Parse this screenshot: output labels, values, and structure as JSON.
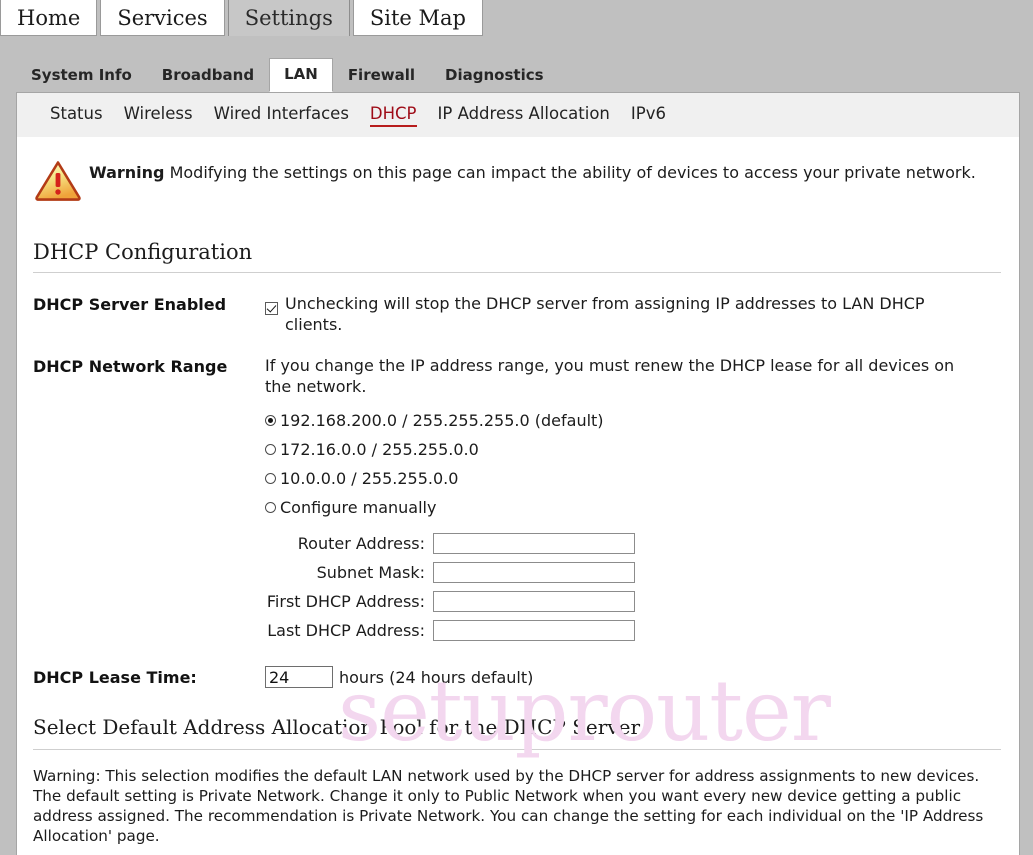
{
  "primary_nav": {
    "items": [
      {
        "label": "Home",
        "active": false
      },
      {
        "label": "Services",
        "active": false
      },
      {
        "label": "Settings",
        "active": true
      },
      {
        "label": "Site Map",
        "active": false
      }
    ]
  },
  "secondary_nav": {
    "items": [
      {
        "label": "System Info",
        "active": false
      },
      {
        "label": "Broadband",
        "active": false
      },
      {
        "label": "LAN",
        "active": true
      },
      {
        "label": "Firewall",
        "active": false
      },
      {
        "label": "Diagnostics",
        "active": false
      }
    ]
  },
  "tertiary_nav": {
    "items": [
      {
        "label": "Status",
        "active": false
      },
      {
        "label": "Wireless",
        "active": false
      },
      {
        "label": "Wired Interfaces",
        "active": false
      },
      {
        "label": "DHCP",
        "active": true
      },
      {
        "label": "IP Address Allocation",
        "active": false
      },
      {
        "label": "IPv6",
        "active": false
      }
    ]
  },
  "warning_banner": {
    "icon": "warning-triangle-icon",
    "bold_prefix": "Warning",
    "text": "Modifying the settings on this page can impact the ability of devices to access your private network."
  },
  "dhcp_configuration": {
    "heading": "DHCP Configuration",
    "server_enabled": {
      "label": "DHCP Server Enabled",
      "checked": true,
      "description": "Unchecking will stop the DHCP server from assigning IP addresses to LAN DHCP clients."
    },
    "network_range": {
      "label": "DHCP Network Range",
      "description": "If you change the IP address range, you must renew the DHCP lease for all devices on the network.",
      "options": [
        {
          "label": "192.168.200.0 / 255.255.255.0 (default)",
          "selected": true
        },
        {
          "label": "172.16.0.0 / 255.255.0.0",
          "selected": false
        },
        {
          "label": "10.0.0.0 / 255.255.0.0",
          "selected": false
        },
        {
          "label": "Configure manually",
          "selected": false
        }
      ],
      "manual_fields": [
        {
          "label": "Router Address:",
          "value": "",
          "placeholder": ""
        },
        {
          "label": "Subnet Mask:",
          "value": "",
          "placeholder": ""
        },
        {
          "label": "First DHCP Address:",
          "value": "",
          "placeholder": ""
        },
        {
          "label": "Last DHCP Address:",
          "value": "",
          "placeholder": ""
        }
      ]
    },
    "lease_time": {
      "label": "DHCP Lease Time:",
      "value": "24",
      "suffix": "hours (24 hours default)"
    }
  },
  "allocation_pool": {
    "heading": "Select Default Address Allocation Pool for the DHCP Server",
    "note": "Warning: This selection modifies the default LAN network used by the DHCP server for address assignments to new devices. The default setting is Private Network. Change it only to Public Network when you want every new device getting a public address assigned. The recommendation is Private Network. You can change the setting for each individual on the 'IP Address Allocation' page."
  },
  "watermark": {
    "text": "setuprouter"
  },
  "colors": {
    "chrome_gray": "#c0c0c0",
    "tertiary_bar": "#f0f0f0",
    "active_link_red": "#9e0b17",
    "watermark_pink": "#f3d7ef",
    "rule_gray": "#cfcfcf"
  }
}
